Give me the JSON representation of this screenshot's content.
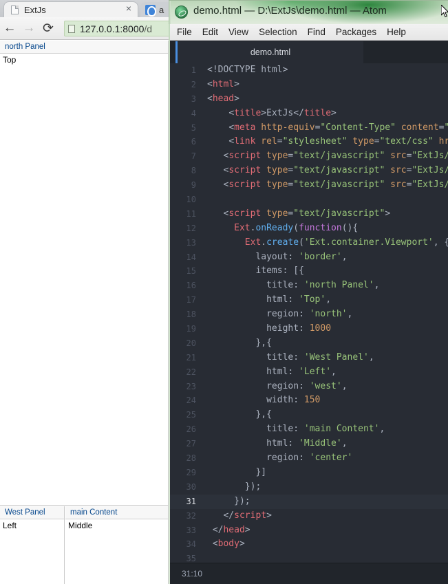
{
  "browser": {
    "tab": {
      "title": "ExtJs",
      "icon": "page-icon",
      "close_label": "×"
    },
    "tab2": {
      "title": "a",
      "icon": "firefox-icon"
    },
    "toolbar": {
      "back_icon": "←",
      "forward_icon": "→",
      "reload_icon": "⟳",
      "url_prefix": "127.0.0.1:8000",
      "url_suffix": "/d"
    },
    "page": {
      "north": {
        "title": "north Panel",
        "body": "Top"
      },
      "west": {
        "title": "West Panel",
        "body": "Left"
      },
      "center": {
        "title": "main Content",
        "body": "Middle"
      }
    }
  },
  "atom": {
    "title": "demo.html — D:\\ExtJs\\demo.html — Atom",
    "menu": [
      "File",
      "Edit",
      "View",
      "Selection",
      "Find",
      "Packages",
      "Help"
    ],
    "tab_label": "demo.html",
    "status": "31:10",
    "active_line": 31,
    "code": [
      {
        "n": 1,
        "tokens": [
          [
            "doctype",
            "<!DOCTYPE html>"
          ]
        ]
      },
      {
        "n": 2,
        "tokens": [
          [
            "punct",
            "<"
          ],
          [
            "tagname",
            "html"
          ],
          [
            "punct",
            ">"
          ]
        ]
      },
      {
        "n": 3,
        "tokens": [
          [
            "punct",
            "<"
          ],
          [
            "tagname",
            "head"
          ],
          [
            "punct",
            ">"
          ]
        ]
      },
      {
        "n": 4,
        "tokens": [
          [
            "plain",
            "    "
          ],
          [
            "punct",
            "<"
          ],
          [
            "tagname",
            "title"
          ],
          [
            "punct",
            ">"
          ],
          [
            "plain",
            "ExtJs"
          ],
          [
            "punct",
            "</"
          ],
          [
            "tagname",
            "title"
          ],
          [
            "punct",
            ">"
          ]
        ]
      },
      {
        "n": 5,
        "tokens": [
          [
            "plain",
            "    "
          ],
          [
            "punct",
            "<"
          ],
          [
            "tagname",
            "meta"
          ],
          [
            "plain",
            " "
          ],
          [
            "attr",
            "http-equiv"
          ],
          [
            "punct",
            "="
          ],
          [
            "str",
            "\"Content-Type\""
          ],
          [
            "plain",
            " "
          ],
          [
            "attr",
            "content"
          ],
          [
            "punct",
            "="
          ],
          [
            "str",
            "\"t"
          ]
        ]
      },
      {
        "n": 6,
        "tokens": [
          [
            "plain",
            "    "
          ],
          [
            "punct",
            "<"
          ],
          [
            "tagname",
            "link"
          ],
          [
            "plain",
            " "
          ],
          [
            "attr",
            "rel"
          ],
          [
            "punct",
            "="
          ],
          [
            "str",
            "\"stylesheet\""
          ],
          [
            "plain",
            " "
          ],
          [
            "attr",
            "type"
          ],
          [
            "punct",
            "="
          ],
          [
            "str",
            "\"text/css\""
          ],
          [
            "plain",
            " "
          ],
          [
            "attr",
            "hre"
          ]
        ]
      },
      {
        "n": 7,
        "tokens": [
          [
            "plain",
            "   "
          ],
          [
            "punct",
            "<"
          ],
          [
            "tagname",
            "script"
          ],
          [
            "plain",
            " "
          ],
          [
            "attr",
            "type"
          ],
          [
            "punct",
            "="
          ],
          [
            "str",
            "\"text/javascript\""
          ],
          [
            "plain",
            " "
          ],
          [
            "attr",
            "src"
          ],
          [
            "punct",
            "="
          ],
          [
            "str",
            "\"ExtJs/"
          ]
        ]
      },
      {
        "n": 8,
        "tokens": [
          [
            "plain",
            "   "
          ],
          [
            "punct",
            "<"
          ],
          [
            "tagname",
            "script"
          ],
          [
            "plain",
            " "
          ],
          [
            "attr",
            "type"
          ],
          [
            "punct",
            "="
          ],
          [
            "str",
            "\"text/javascript\""
          ],
          [
            "plain",
            " "
          ],
          [
            "attr",
            "src"
          ],
          [
            "punct",
            "="
          ],
          [
            "str",
            "\"ExtJs/"
          ]
        ]
      },
      {
        "n": 9,
        "tokens": [
          [
            "plain",
            "   "
          ],
          [
            "punct",
            "<"
          ],
          [
            "tagname",
            "script"
          ],
          [
            "plain",
            " "
          ],
          [
            "attr",
            "type"
          ],
          [
            "punct",
            "="
          ],
          [
            "str",
            "\"text/javascript\""
          ],
          [
            "plain",
            " "
          ],
          [
            "attr",
            "src"
          ],
          [
            "punct",
            "="
          ],
          [
            "str",
            "\"ExtJs/"
          ]
        ]
      },
      {
        "n": 10,
        "tokens": []
      },
      {
        "n": 11,
        "tokens": [
          [
            "plain",
            "   "
          ],
          [
            "punct",
            "<"
          ],
          [
            "tagname",
            "script"
          ],
          [
            "plain",
            " "
          ],
          [
            "attr",
            "type"
          ],
          [
            "punct",
            "="
          ],
          [
            "str",
            "\"text/javascript\""
          ],
          [
            "punct",
            ">"
          ]
        ]
      },
      {
        "n": 12,
        "tokens": [
          [
            "plain",
            "     "
          ],
          [
            "cls",
            "Ext"
          ],
          [
            "punct",
            "."
          ],
          [
            "fn",
            "onReady"
          ],
          [
            "punct",
            "("
          ],
          [
            "kw",
            "function"
          ],
          [
            "punct",
            "(){"
          ]
        ]
      },
      {
        "n": 13,
        "tokens": [
          [
            "plain",
            "       "
          ],
          [
            "cls",
            "Ext"
          ],
          [
            "punct",
            "."
          ],
          [
            "fn",
            "create"
          ],
          [
            "punct",
            "("
          ],
          [
            "str",
            "'Ext.container.Viewport'"
          ],
          [
            "punct",
            ", {"
          ]
        ]
      },
      {
        "n": 14,
        "tokens": [
          [
            "plain",
            "         "
          ],
          [
            "prop",
            "layout"
          ],
          [
            "punct",
            ": "
          ],
          [
            "str",
            "'border'"
          ],
          [
            "punct",
            ","
          ]
        ]
      },
      {
        "n": 15,
        "tokens": [
          [
            "plain",
            "         "
          ],
          [
            "prop",
            "items"
          ],
          [
            "punct",
            ": [{"
          ]
        ]
      },
      {
        "n": 16,
        "tokens": [
          [
            "plain",
            "           "
          ],
          [
            "prop",
            "title"
          ],
          [
            "punct",
            ": "
          ],
          [
            "str",
            "'north Panel'"
          ],
          [
            "punct",
            ","
          ]
        ]
      },
      {
        "n": 17,
        "tokens": [
          [
            "plain",
            "           "
          ],
          [
            "prop",
            "html"
          ],
          [
            "punct",
            ": "
          ],
          [
            "str",
            "'Top'"
          ],
          [
            "punct",
            ","
          ]
        ]
      },
      {
        "n": 18,
        "tokens": [
          [
            "plain",
            "           "
          ],
          [
            "prop",
            "region"
          ],
          [
            "punct",
            ": "
          ],
          [
            "str",
            "'north'"
          ],
          [
            "punct",
            ","
          ]
        ]
      },
      {
        "n": 19,
        "tokens": [
          [
            "plain",
            "           "
          ],
          [
            "prop",
            "height"
          ],
          [
            "punct",
            ": "
          ],
          [
            "num",
            "1000"
          ]
        ]
      },
      {
        "n": 20,
        "tokens": [
          [
            "plain",
            "         "
          ],
          [
            "punct",
            "},{"
          ]
        ]
      },
      {
        "n": 21,
        "tokens": [
          [
            "plain",
            "           "
          ],
          [
            "prop",
            "title"
          ],
          [
            "punct",
            ": "
          ],
          [
            "str",
            "'West Panel'"
          ],
          [
            "punct",
            ","
          ]
        ]
      },
      {
        "n": 22,
        "tokens": [
          [
            "plain",
            "           "
          ],
          [
            "prop",
            "html"
          ],
          [
            "punct",
            ": "
          ],
          [
            "str",
            "'Left'"
          ],
          [
            "punct",
            ","
          ]
        ]
      },
      {
        "n": 23,
        "tokens": [
          [
            "plain",
            "           "
          ],
          [
            "prop",
            "region"
          ],
          [
            "punct",
            ": "
          ],
          [
            "str",
            "'west'"
          ],
          [
            "punct",
            ","
          ]
        ]
      },
      {
        "n": 24,
        "tokens": [
          [
            "plain",
            "           "
          ],
          [
            "prop",
            "width"
          ],
          [
            "punct",
            ": "
          ],
          [
            "num",
            "150"
          ]
        ]
      },
      {
        "n": 25,
        "tokens": [
          [
            "plain",
            "         "
          ],
          [
            "punct",
            "},{"
          ]
        ]
      },
      {
        "n": 26,
        "tokens": [
          [
            "plain",
            "           "
          ],
          [
            "prop",
            "title"
          ],
          [
            "punct",
            ": "
          ],
          [
            "str",
            "'main Content'"
          ],
          [
            "punct",
            ","
          ]
        ]
      },
      {
        "n": 27,
        "tokens": [
          [
            "plain",
            "           "
          ],
          [
            "prop",
            "html"
          ],
          [
            "punct",
            ": "
          ],
          [
            "str",
            "'Middle'"
          ],
          [
            "punct",
            ","
          ]
        ]
      },
      {
        "n": 28,
        "tokens": [
          [
            "plain",
            "           "
          ],
          [
            "prop",
            "region"
          ],
          [
            "punct",
            ": "
          ],
          [
            "str",
            "'center'"
          ]
        ]
      },
      {
        "n": 29,
        "tokens": [
          [
            "plain",
            "         "
          ],
          [
            "punct",
            "}]"
          ]
        ]
      },
      {
        "n": 30,
        "tokens": [
          [
            "plain",
            "       "
          ],
          [
            "punct",
            "});"
          ]
        ]
      },
      {
        "n": 31,
        "tokens": [
          [
            "plain",
            "     "
          ],
          [
            "punct",
            "});"
          ]
        ]
      },
      {
        "n": 32,
        "tokens": [
          [
            "plain",
            "   "
          ],
          [
            "punct",
            "</"
          ],
          [
            "tagname",
            "script"
          ],
          [
            "punct",
            ">"
          ]
        ]
      },
      {
        "n": 33,
        "tokens": [
          [
            "plain",
            " "
          ],
          [
            "punct",
            "</"
          ],
          [
            "tagname",
            "head"
          ],
          [
            "punct",
            ">"
          ]
        ]
      },
      {
        "n": 34,
        "tokens": [
          [
            "plain",
            " "
          ],
          [
            "punct",
            "<"
          ],
          [
            "tagname",
            "body"
          ],
          [
            "punct",
            ">"
          ]
        ]
      },
      {
        "n": 35,
        "tokens": []
      }
    ]
  }
}
